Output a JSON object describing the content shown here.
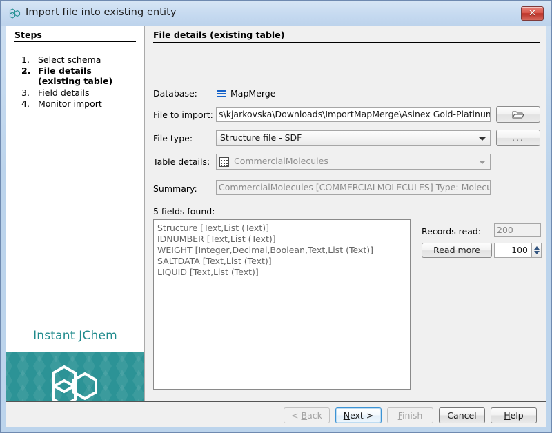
{
  "window": {
    "title": "Import file into existing entity",
    "icon": "hexagon-molecule-icon",
    "close_label": "✕"
  },
  "steps": {
    "heading": "Steps",
    "items": [
      {
        "num": "1.",
        "label": "Select schema",
        "current": false
      },
      {
        "num": "2.",
        "label": "File details (existing table)",
        "current": true
      },
      {
        "num": "3.",
        "label": "Field details",
        "current": false
      },
      {
        "num": "4.",
        "label": "Monitor import",
        "current": false
      }
    ],
    "brand": "Instant JChem"
  },
  "content": {
    "heading": "File details (existing table)",
    "database": {
      "label": "Database:",
      "value": "MapMerge"
    },
    "file_to_import": {
      "label": "File to import:",
      "value": "s\\kjarkovska\\Downloads\\ImportMapMerge\\Asinex Gold-Platinum.sdf",
      "browse_icon": "folder-icon"
    },
    "file_type": {
      "label": "File type:",
      "value": "Structure file - SDF",
      "options_button": "..."
    },
    "table_details": {
      "label": "Table details:",
      "value": "CommercialMolecules"
    },
    "summary": {
      "label": "Summary:",
      "value": "CommercialMolecules [COMMERCIALMOLECULES] Type: Molecules"
    },
    "fields": {
      "label": "5 fields found:",
      "rows": [
        "Structure [Text,List (Text)]",
        "IDNUMBER [Text,List (Text)]",
        "WEIGHT [Integer,Decimal,Boolean,Text,List (Text)]",
        "SALTDATA [Text,List (Text)]",
        "LIQUID [Text,List (Text)]"
      ]
    },
    "records": {
      "label": "Records read:",
      "value": "200",
      "read_more_label": "Read more",
      "count": "100"
    }
  },
  "buttons": {
    "back": "< Back",
    "next": "Next >",
    "finish": "Finish",
    "cancel": "Cancel",
    "help": "Help"
  },
  "colors": {
    "brand_teal": "#2c9396",
    "title_blue": "#bcd4ec",
    "link_blue": "#1763c9"
  }
}
